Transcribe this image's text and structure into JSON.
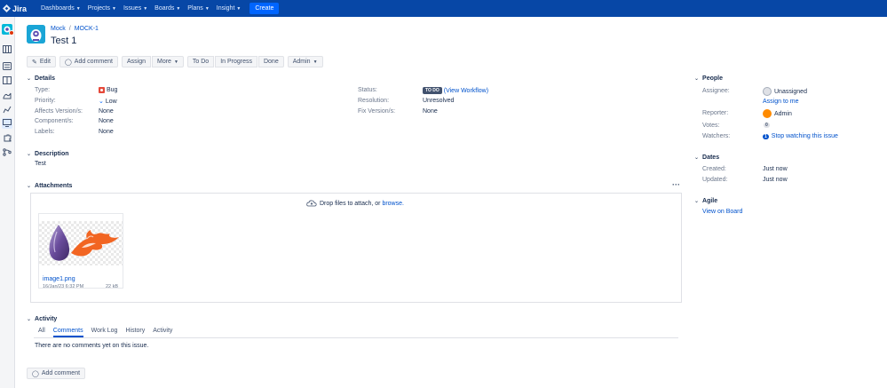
{
  "nav": {
    "logo": "Jira",
    "items": [
      "Dashboards",
      "Projects",
      "Issues",
      "Boards",
      "Plans",
      "Insight"
    ],
    "create": "Create"
  },
  "sidebar_icons": [
    "project-avatar",
    "board-icon",
    "backlog-icon",
    "board-columns-icon",
    "releases-icon",
    "reports-icon",
    "issues-icon",
    "components-icon",
    "code-icon"
  ],
  "breadcrumb": {
    "project": "Mock",
    "sep": "/",
    "issue_key": "MOCK-1"
  },
  "issue": {
    "title": "Test 1"
  },
  "toolbar": {
    "edit": "Edit",
    "add_comment": "Add comment",
    "assign": "Assign",
    "more": "More",
    "todo": "To Do",
    "in_progress": "In Progress",
    "done": "Done",
    "admin": "Admin"
  },
  "details": {
    "heading": "Details",
    "type_label": "Type:",
    "type_value": "Bug",
    "priority_label": "Priority:",
    "priority_value": "Low",
    "affects_label": "Affects Version/s:",
    "affects_value": "None",
    "component_label": "Component/s:",
    "component_value": "None",
    "labels_label": "Labels:",
    "labels_value": "None",
    "status_label": "Status:",
    "status_lozenge": "TO DO",
    "status_link": "(View Workflow)",
    "resolution_label": "Resolution:",
    "resolution_value": "Unresolved",
    "fix_label": "Fix Version/s:",
    "fix_value": "None"
  },
  "description": {
    "heading": "Description",
    "text": "Test"
  },
  "attachments": {
    "heading": "Attachments",
    "drop_text": "Drop files to attach, or",
    "browse": "browse.",
    "file_name": "image1.png",
    "file_date": "16/Jan/23 6:32 PM",
    "file_size": "22 kB"
  },
  "activity": {
    "heading": "Activity",
    "tabs": [
      "All",
      "Comments",
      "Work Log",
      "History",
      "Activity"
    ],
    "active_tab": "Comments",
    "empty": "There are no comments yet on this issue.",
    "add_comment": "Add comment"
  },
  "people": {
    "heading": "People",
    "assignee_label": "Assignee:",
    "assignee_value": "Unassigned",
    "assign_to_me": "Assign to me",
    "reporter_label": "Reporter:",
    "reporter_value": "Admin",
    "votes_label": "Votes:",
    "votes_value": "0",
    "watchers_label": "Watchers:",
    "watchers_count": "1",
    "watchers_link": "Stop watching this issue"
  },
  "dates": {
    "heading": "Dates",
    "created_label": "Created:",
    "created_value": "Just now",
    "updated_label": "Updated:",
    "updated_value": "Just now"
  },
  "agile": {
    "heading": "Agile",
    "link": "View on Board"
  },
  "colors": {
    "nav": "#0747a6",
    "create": "#0065ff",
    "link": "#0052cc",
    "bug": "#e5493a"
  }
}
